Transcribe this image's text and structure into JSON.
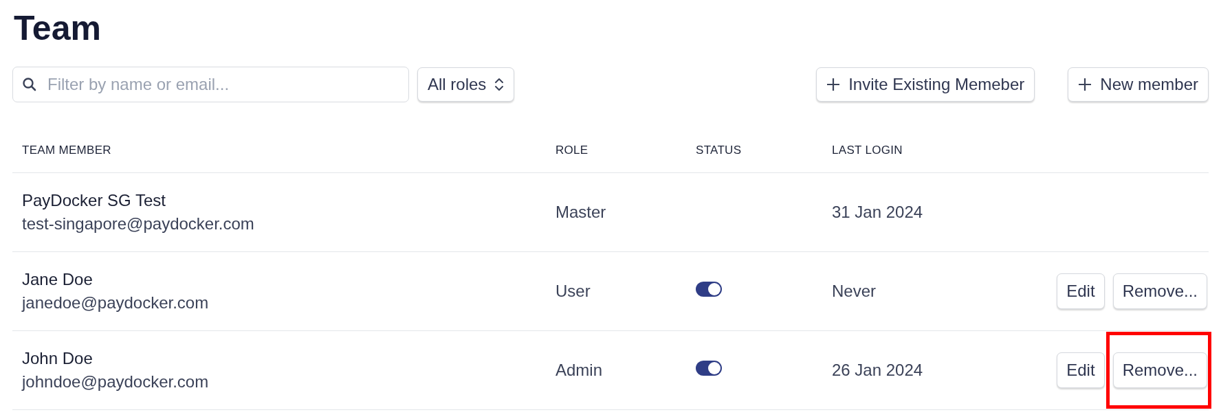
{
  "title": "Team",
  "toolbar": {
    "search": {
      "placeholder": "Filter by name or email..."
    },
    "role_filter": "All roles",
    "buttons": [
      {
        "label": "Invite Existing Memeber"
      },
      {
        "label": "New member"
      }
    ]
  },
  "table": {
    "columns": [
      "TEAM MEMBER",
      "ROLE",
      "STATUS",
      "LAST LOGIN"
    ],
    "rows": [
      {
        "name": "PayDocker SG Test",
        "email": "test-singapore@paydocker.com",
        "role": "Master",
        "last_login": "31 Jan 2024",
        "actions": []
      },
      {
        "name": "Jane Doe",
        "email": "janedoe@paydocker.com",
        "role": "User",
        "status_on": true,
        "last_login": "Never",
        "actions": [
          {
            "label": "Edit",
            "highlighted": false
          },
          {
            "label": "Remove...",
            "highlighted": false
          }
        ]
      },
      {
        "name": "John Doe",
        "email": "johndoe@paydocker.com",
        "role": "Admin",
        "status_on": true,
        "last_login": "26 Jan 2024",
        "actions": [
          {
            "label": "Edit",
            "highlighted": false
          },
          {
            "label": "Remove...",
            "highlighted": true
          }
        ]
      }
    ]
  }
}
